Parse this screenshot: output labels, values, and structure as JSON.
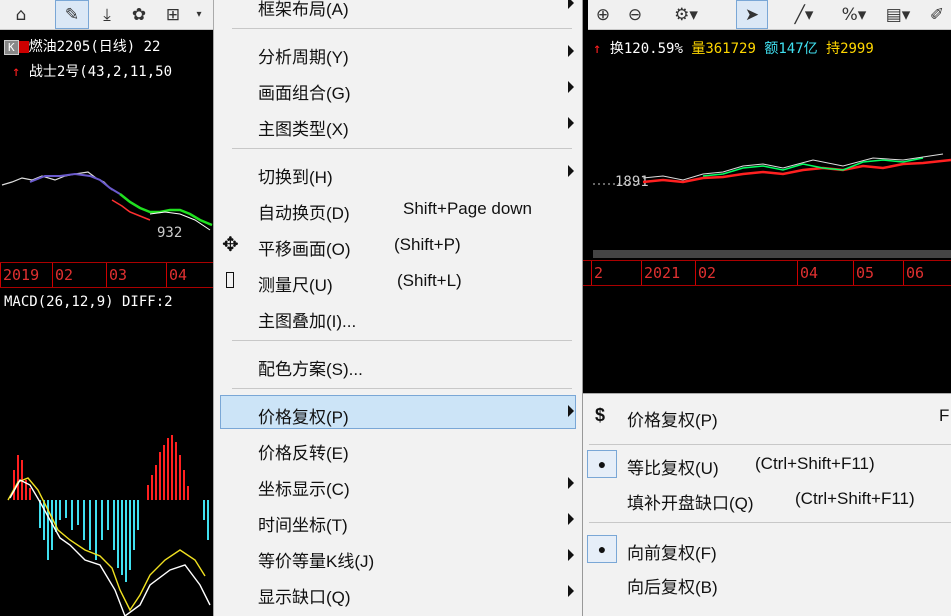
{
  "toolbar": {
    "left_icons": [
      "home-icon",
      "ruler-icon",
      "download-icon",
      "gear-icon",
      "grid-icon"
    ],
    "right_icons": [
      "zoom-in-icon",
      "zoom-out-icon",
      "settings-icon",
      "cursor-icon",
      "line-tool-icon",
      "percent-icon",
      "table-icon",
      "brush-icon"
    ]
  },
  "left_chart": {
    "k_badge": "K",
    "title": "燃油2205(日线) 22",
    "indicator": "战士2号(43,2,11,50",
    "price_low_label": "932",
    "timeline": [
      "2019",
      "02",
      "03",
      "04"
    ],
    "macd_label": "MACD(26,12,9) DIFF:2"
  },
  "right_chart": {
    "stats_turnover": "换120.59%",
    "stats_volume": "量361729",
    "stats_amount": "额147亿",
    "stats_position": "持2999",
    "price_label": "1891",
    "timeline": [
      "2",
      "2021",
      "02",
      "04",
      "05",
      "06"
    ]
  },
  "menu": {
    "top_cut": "框架布局(A)",
    "items": [
      {
        "label": "分析周期(Y)",
        "shortcut": "",
        "submenu": true
      },
      {
        "label": "画面组合(G)",
        "shortcut": "",
        "submenu": true
      },
      {
        "label": "主图类型(X)",
        "shortcut": "",
        "submenu": true
      },
      {
        "label": "切换到(H)",
        "shortcut": "",
        "submenu": true
      },
      {
        "label": "自动换页(D)",
        "shortcut": "Shift+Page down",
        "submenu": false
      },
      {
        "label": "平移画面(O)",
        "shortcut": "(Shift+P)",
        "submenu": false,
        "icon": "pan-icon"
      },
      {
        "label": "测量尺(U)",
        "shortcut": "(Shift+L)",
        "submenu": false,
        "icon": "ruler-icon"
      },
      {
        "label": "主图叠加(I)...",
        "shortcut": "",
        "submenu": false
      },
      {
        "label": "配色方案(S)...",
        "shortcut": "",
        "submenu": false
      },
      {
        "label": "价格复权(P)",
        "shortcut": "",
        "submenu": true
      },
      {
        "label": "价格反转(E)",
        "shortcut": "",
        "submenu": false
      },
      {
        "label": "坐标显示(C)",
        "shortcut": "",
        "submenu": true
      },
      {
        "label": "时间坐标(T)",
        "shortcut": "",
        "submenu": true
      },
      {
        "label": "等价等量K线(J)",
        "shortcut": "",
        "submenu": true
      },
      {
        "label": "显示缺口(Q)",
        "shortcut": "",
        "submenu": true
      }
    ],
    "highlighted": "价格复权(P)"
  },
  "submenu": {
    "items": [
      {
        "label": "价格复权(P)",
        "shortcut": "F",
        "icon": "$",
        "checked": false
      },
      {
        "label": "等比复权(U)",
        "shortcut": "(Ctrl+Shift+F11)",
        "checked": true
      },
      {
        "label": "填补开盘缺口(Q)",
        "shortcut": "(Ctrl+Shift+F11)",
        "checked": false
      },
      {
        "label": "向前复权(F)",
        "shortcut": "",
        "checked": true
      },
      {
        "label": "向后复权(B)",
        "shortcut": "",
        "checked": false
      }
    ]
  },
  "colors": {
    "up": "#ff2020",
    "down": "#00ff60",
    "axis": "#c00000",
    "menu_bg": "#f2f2f2",
    "highlight": "#cce4f7"
  }
}
